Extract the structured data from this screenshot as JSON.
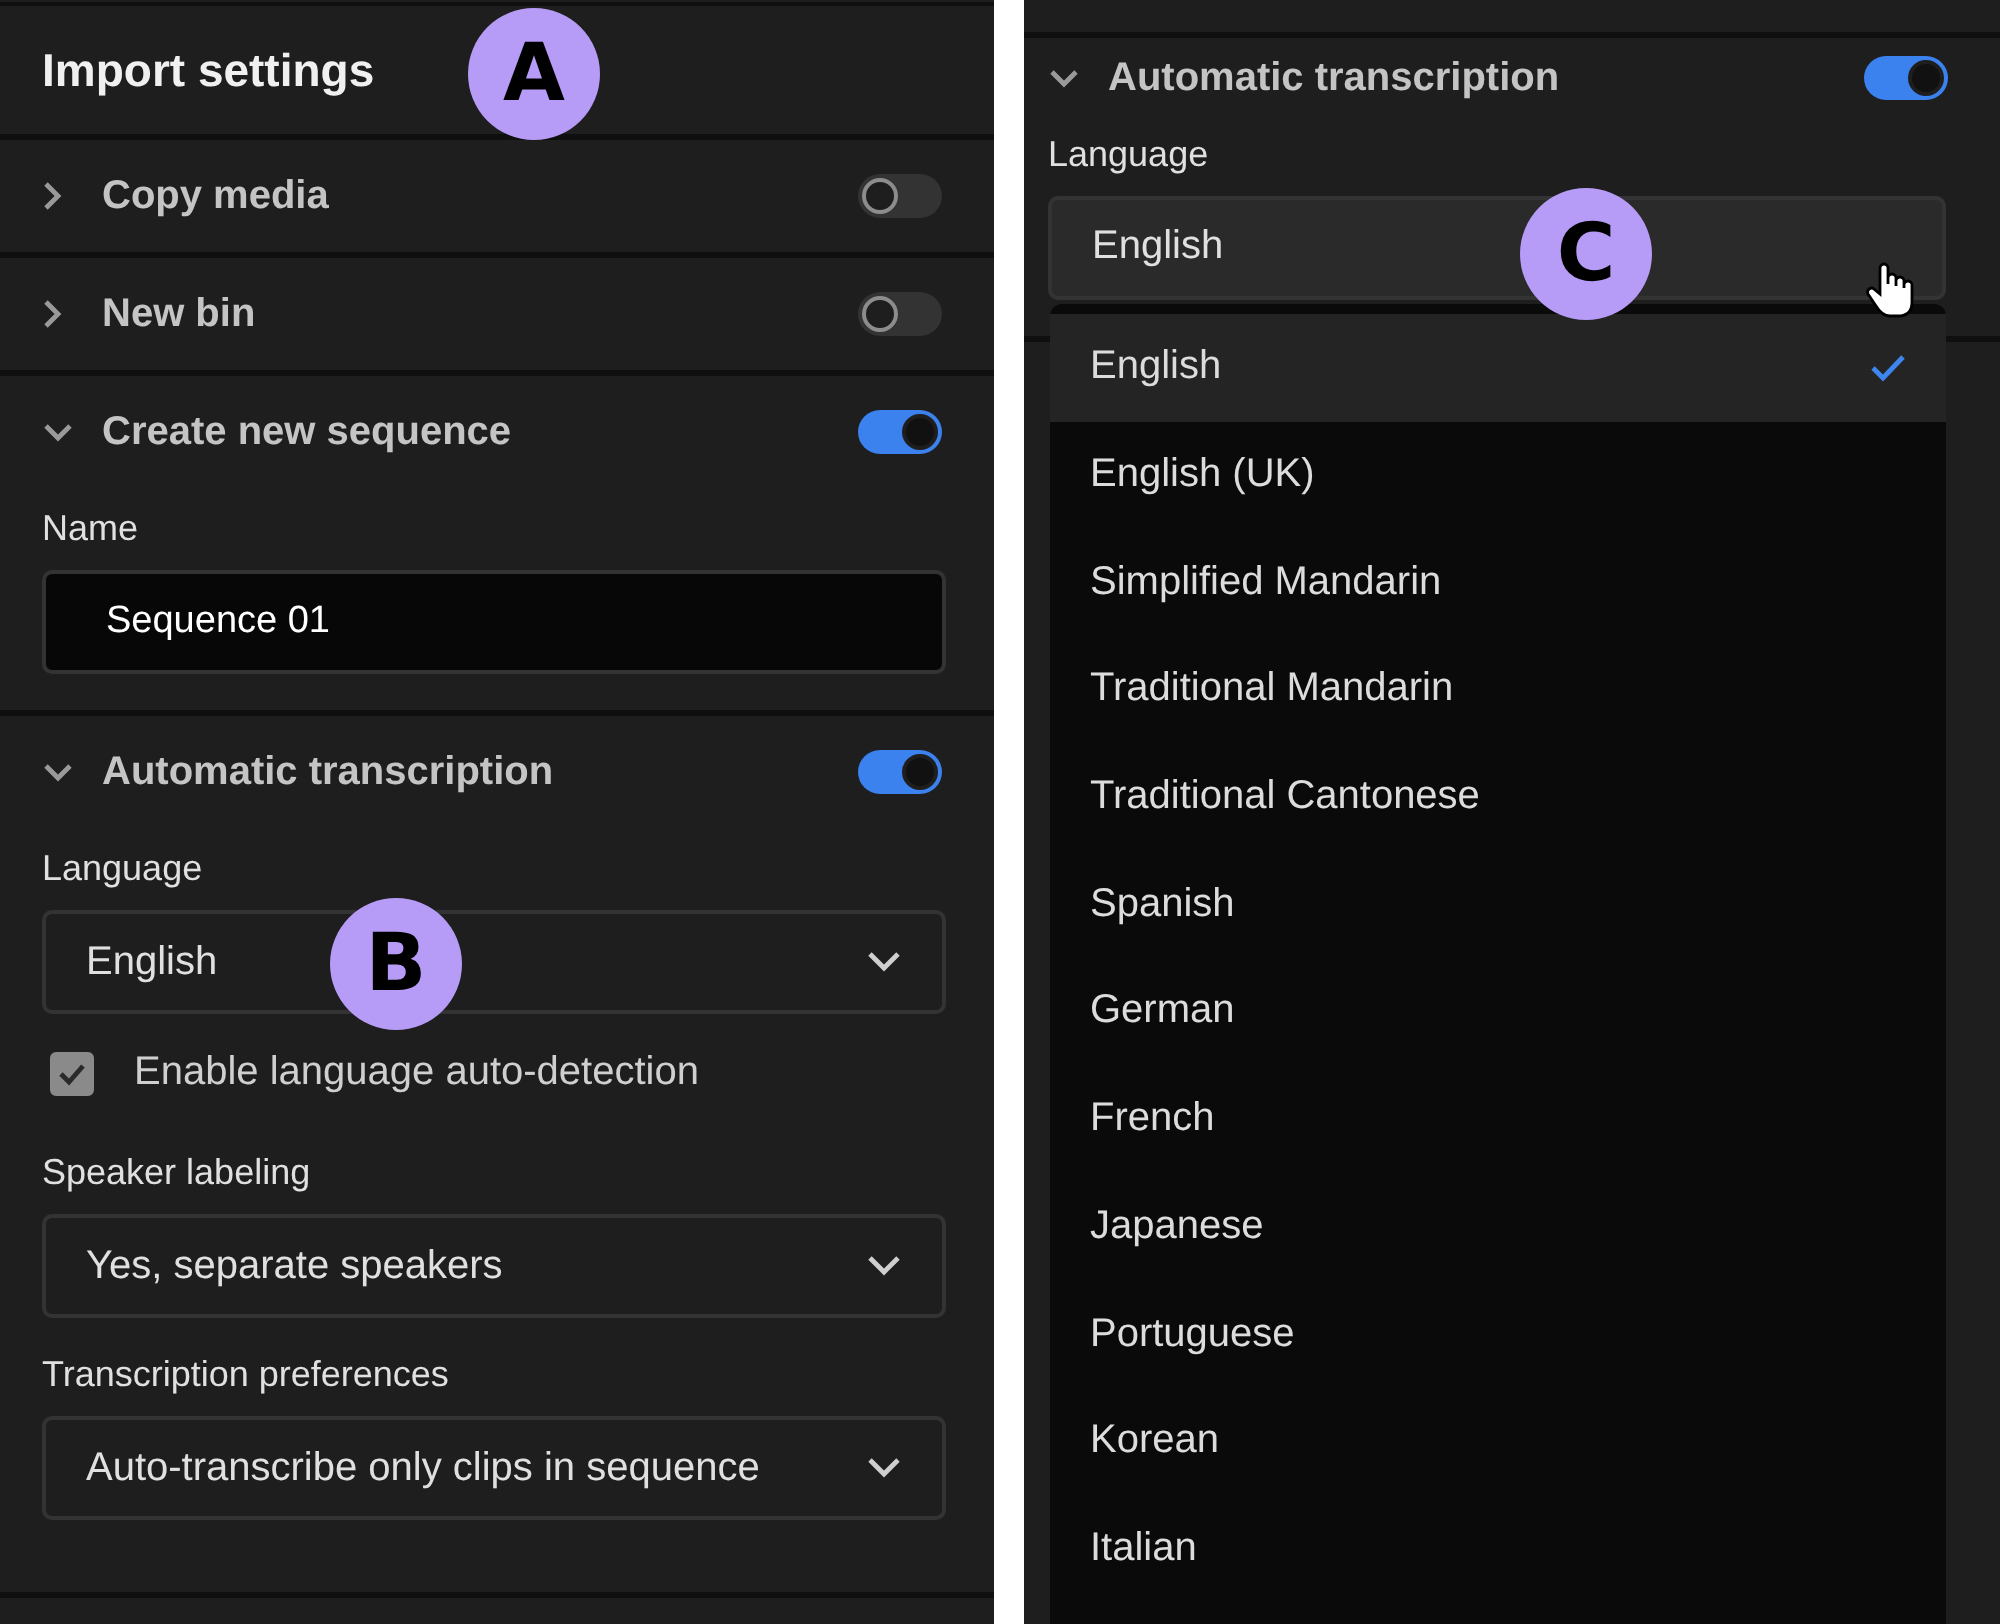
{
  "left_panel": {
    "title": "Import settings",
    "sections": [
      {
        "title": "Copy media",
        "expanded": false,
        "on": false
      },
      {
        "title": "New bin",
        "expanded": false,
        "on": false
      },
      {
        "title": "Create new sequence",
        "expanded": true,
        "on": true,
        "fields": [
          {
            "kind": "text",
            "label": "Name",
            "value": "Sequence 01"
          }
        ]
      },
      {
        "title": "Automatic transcription",
        "expanded": true,
        "on": true,
        "fields": [
          {
            "kind": "select",
            "label": "Language",
            "value": "English"
          },
          {
            "kind": "checkbox",
            "label": "Enable language auto-detection",
            "checked": true
          },
          {
            "kind": "select",
            "label": "Speaker labeling",
            "value": "Yes, separate speakers"
          },
          {
            "kind": "select",
            "label": "Transcription preferences",
            "value": "Auto-transcribe only clips in sequence"
          }
        ]
      }
    ]
  },
  "right_panel": {
    "section": {
      "title": "Automatic transcription",
      "expanded": true,
      "on": true
    },
    "language_label": "Language",
    "language_select": {
      "value": "English"
    },
    "menu": [
      {
        "label": "English",
        "selected": true
      },
      {
        "label": "English (UK)",
        "selected": false
      },
      {
        "label": "Simplified Mandarin",
        "selected": false
      },
      {
        "label": "Traditional Mandarin",
        "selected": false
      },
      {
        "label": "Traditional Cantonese",
        "selected": false
      },
      {
        "label": "Spanish",
        "selected": false
      },
      {
        "label": "German",
        "selected": false
      },
      {
        "label": "French",
        "selected": false
      },
      {
        "label": "Japanese",
        "selected": false
      },
      {
        "label": "Portuguese",
        "selected": false
      },
      {
        "label": "Korean",
        "selected": false
      },
      {
        "label": "Italian",
        "selected": false
      }
    ]
  },
  "callouts": [
    {
      "label": "A"
    },
    {
      "label": "B"
    },
    {
      "label": "C"
    }
  ]
}
